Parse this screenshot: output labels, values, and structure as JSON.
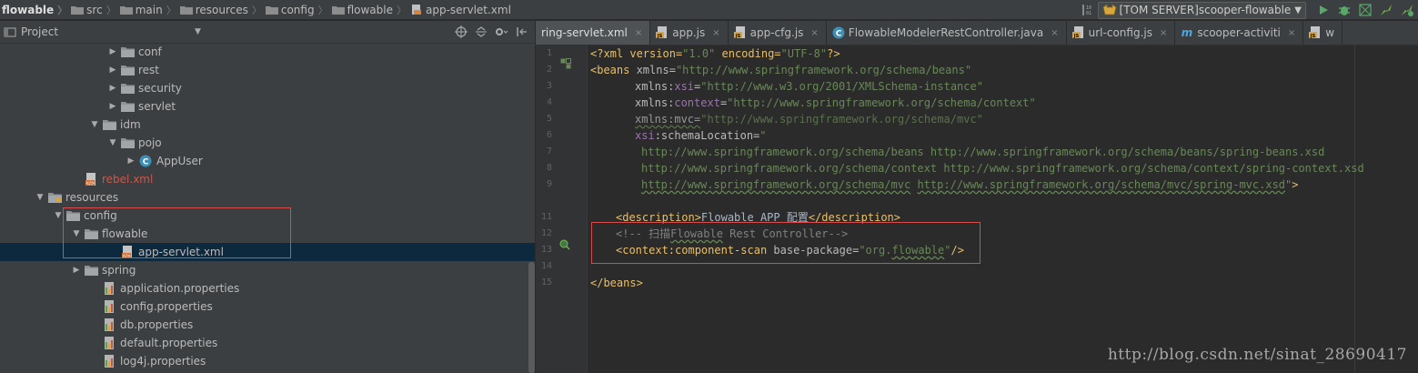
{
  "breadcrumbs": [
    "flowable",
    "src",
    "main",
    "resources",
    "config",
    "flowable",
    "app-servlet.xml"
  ],
  "run_config": {
    "label": "[TOM SERVER]scooper-flowable"
  },
  "project_panel": {
    "title": "Project",
    "tree": [
      {
        "label": "conf",
        "indent": 7,
        "expanded": false,
        "icon": "folder-icon"
      },
      {
        "label": "rest",
        "indent": 7,
        "expanded": false,
        "icon": "folder-icon"
      },
      {
        "label": "security",
        "indent": 7,
        "expanded": false,
        "icon": "folder-icon"
      },
      {
        "label": "servlet",
        "indent": 7,
        "expanded": false,
        "icon": "folder-icon"
      },
      {
        "label": "idm",
        "indent": 6,
        "expanded": true,
        "icon": "folder-icon"
      },
      {
        "label": "pojo",
        "indent": 7,
        "expanded": true,
        "icon": "folder-icon"
      },
      {
        "label": "AppUser",
        "indent": 8,
        "expanded": false,
        "icon": "class-icon"
      },
      {
        "label": "rebel.xml",
        "indent": 5,
        "leaf": true,
        "icon": "xml-file-icon",
        "style": "red"
      },
      {
        "label": "resources",
        "indent": 3,
        "expanded": true,
        "icon": "resources-folder-icon"
      },
      {
        "label": "config",
        "indent": 4,
        "expanded": true,
        "icon": "folder-icon"
      },
      {
        "label": "flowable",
        "indent": 5,
        "expanded": true,
        "icon": "folder-icon"
      },
      {
        "label": "app-servlet.xml",
        "indent": 7,
        "leaf": true,
        "icon": "xml-file-icon",
        "selected": true
      },
      {
        "label": "spring",
        "indent": 5,
        "expanded": false,
        "icon": "folder-icon"
      },
      {
        "label": "application.properties",
        "indent": 6,
        "leaf": true,
        "icon": "properties-file-icon"
      },
      {
        "label": "config.properties",
        "indent": 6,
        "leaf": true,
        "icon": "properties-file-icon"
      },
      {
        "label": "db.properties",
        "indent": 6,
        "leaf": true,
        "icon": "properties-file-icon"
      },
      {
        "label": "default.properties",
        "indent": 6,
        "leaf": true,
        "icon": "properties-file-icon"
      },
      {
        "label": "log4j.properties",
        "indent": 6,
        "leaf": true,
        "icon": "properties-file-icon"
      }
    ]
  },
  "editor": {
    "tabs": [
      {
        "label": "ring-servlet.xml",
        "icon": "none",
        "active": true
      },
      {
        "label": "app.js",
        "icon": "js-file-icon"
      },
      {
        "label": "app-cfg.js",
        "icon": "js-file-icon"
      },
      {
        "label": "FlowableModelerRestController.java",
        "icon": "class-icon"
      },
      {
        "label": "url-config.js",
        "icon": "js-file-icon"
      },
      {
        "label": "scooper-activiti",
        "icon": "maven-icon"
      },
      {
        "label": "w",
        "icon": "js-file-icon"
      }
    ],
    "line_numbers": [
      "1",
      "2",
      "3",
      "4",
      "5",
      "6",
      "7",
      "8",
      "9",
      "11",
      "12",
      "13",
      "14",
      "15"
    ],
    "code": {
      "l1": [
        "<?xml version=",
        "\"1.0\"",
        " encoding=",
        "\"UTF-8\"",
        "?>"
      ],
      "l2": [
        "<beans ",
        "xmlns=",
        "\"http://www.springframework.org/schema/beans\""
      ],
      "l3": [
        "xmlns:",
        "xsi",
        "=",
        "\"http://www.w3.org/2001/XMLSchema-instance\""
      ],
      "l4": [
        "xmlns:",
        "context",
        "=",
        "\"http://www.springframework.org/schema/context\""
      ],
      "l5": [
        "xmlns:mvc=",
        "\"http://www.springframework.org/schema/mvc\""
      ],
      "l6": [
        "xsi",
        ":schemaLocation=",
        "\""
      ],
      "l7": "http://www.springframework.org/schema/beans http://www.springframework.org/schema/beans/spring-beans.xsd",
      "l8": "http://www.springframework.org/schema/context http://www.springframework.org/schema/context/spring-context.xsd",
      "l9": [
        "http://www.springframework.org/schema/mvc",
        " ",
        "http://www.springframework.org/schema/mvc/spring-mvc.xsd",
        "\"",
        ">"
      ],
      "l11": [
        "<description>",
        "Flowable APP 配置",
        "</description>"
      ],
      "l12": [
        "<!-- 扫描",
        "Flowable",
        " Rest Controller-->"
      ],
      "l13": [
        "<context:",
        "component-scan ",
        "base-package=",
        "\"org.",
        "flowable",
        "\"",
        "/>"
      ],
      "l15": "</beans>"
    }
  },
  "watermark": "http://blog.csdn.net/sinat_28690417"
}
